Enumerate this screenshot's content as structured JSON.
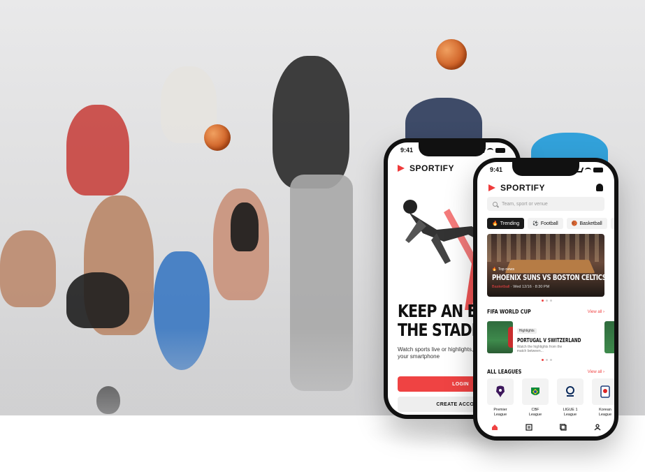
{
  "colors": {
    "accent": "#ef4343",
    "dark": "#111111",
    "hero_bg": "#dcdcdd"
  },
  "back_phone": {
    "time": "9:41",
    "brand": "SPORTIFY",
    "headline_1": "KEEP AN EYE",
    "headline_2": "THE STADIUM",
    "subtext": "Watch sports live or highlights, read news from your smartphone",
    "login_label": "LOGIN",
    "create_label": "CREATE ACCOUNT"
  },
  "front_phone": {
    "time": "9:41",
    "brand": "SPORTIFY",
    "search_placeholder": "Team, sport or venue",
    "chips": [
      {
        "icon": "fire-icon",
        "glyph": "🔥",
        "label": "Trending"
      },
      {
        "icon": "soccer-ball-icon",
        "glyph": "⚽",
        "label": "Football"
      },
      {
        "icon": "basketball-icon",
        "glyph": "🏀",
        "label": "Basketball"
      },
      {
        "icon": "more-sport-icon",
        "glyph": "🏸",
        "label": ""
      }
    ],
    "featured": {
      "tag": "Top news",
      "title": "PHOENIX SUNS VS BOSTON CELTICS",
      "sport": "Basketball",
      "date": "· Wed 12/16 · 8:30 PM"
    },
    "world_cup": {
      "section_title": "FIFA WORLD CUP",
      "view_all": "View all",
      "badge": "Highlights",
      "title": "PORTUGAL V SWITZERLAND",
      "desc": "Watch the highlights from the match between..."
    },
    "leagues": {
      "section_title": "ALL LEAGUES",
      "view_all": "View all",
      "items": [
        {
          "name": "Premier League",
          "line1": "Premier",
          "line2": "League"
        },
        {
          "name": "CBF League",
          "line1": "CBF",
          "line2": "League"
        },
        {
          "name": "LIGUE 1 League",
          "line1": "LIGUE 1",
          "line2": "League"
        },
        {
          "name": "Korean League",
          "line1": "Korean",
          "line2": "League"
        }
      ]
    }
  }
}
